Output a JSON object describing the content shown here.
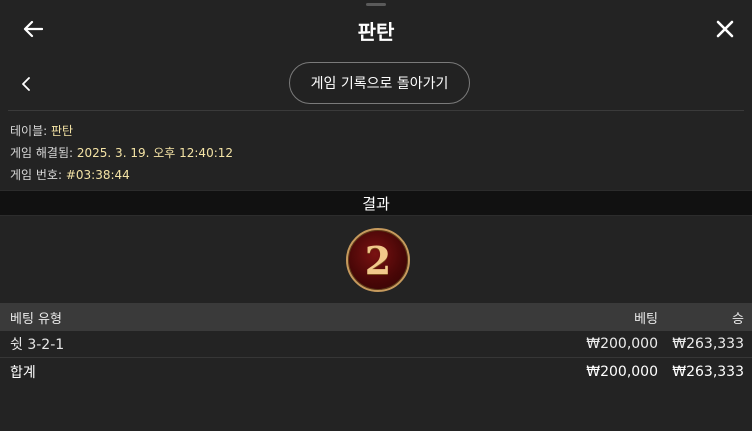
{
  "header": {
    "title": "판탄",
    "back_icon": "arrow-left-icon",
    "close_icon": "close-icon"
  },
  "nav": {
    "chevron_icon": "chevron-left-icon",
    "back_to_history_label": "게임 기록으로 돌아가기"
  },
  "info": {
    "table_label": "테이블:",
    "table_value": "판탄",
    "resolved_label": "게임 해결됨:",
    "resolved_value": "2025. 3. 19. 오후 12:40:12",
    "game_no_label": "게임 번호:",
    "game_no_value": "#03:38:44"
  },
  "result": {
    "title": "결과",
    "number": "2"
  },
  "bets_table": {
    "headers": {
      "type": "베팅 유형",
      "bet": "베팅",
      "win": "승"
    },
    "rows": [
      {
        "type": "쉿 3-2-1",
        "bet": "₩200,000",
        "win": "₩263,333"
      }
    ],
    "total": {
      "type": "합계",
      "bet": "₩200,000",
      "win": "₩263,333"
    }
  },
  "colors": {
    "background": "#232323",
    "info_value": "#f4e3a5",
    "ball_fill": "#5a0a0a",
    "ball_ring": "#c69a5d"
  }
}
